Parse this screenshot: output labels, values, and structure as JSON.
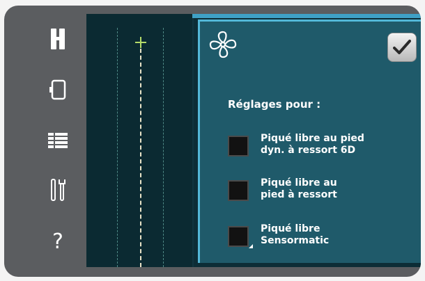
{
  "sidebar": {
    "icons": [
      {
        "name": "presser-foot-icon"
      },
      {
        "name": "hoop-icon"
      },
      {
        "name": "menu-list-icon"
      },
      {
        "name": "settings-tools-icon"
      },
      {
        "name": "help-icon",
        "glyph": "?"
      }
    ]
  },
  "panel": {
    "title": "Réglages pour :",
    "confirm_icon": "checkmark-icon",
    "options": [
      {
        "label": "Piqué libre au pied\ndyn. à ressort 6D",
        "checked": false
      },
      {
        "label": "Piqué libre au\npied à ressort",
        "checked": false
      },
      {
        "label": "Piqué libre\nSensormatic",
        "checked": false
      }
    ]
  },
  "colors": {
    "frame": "#5b5d60",
    "screen": "#0c2d36",
    "panel": "#1f5a6a",
    "panel_border": "#53b8d8",
    "needle": "#e9e3c8"
  }
}
